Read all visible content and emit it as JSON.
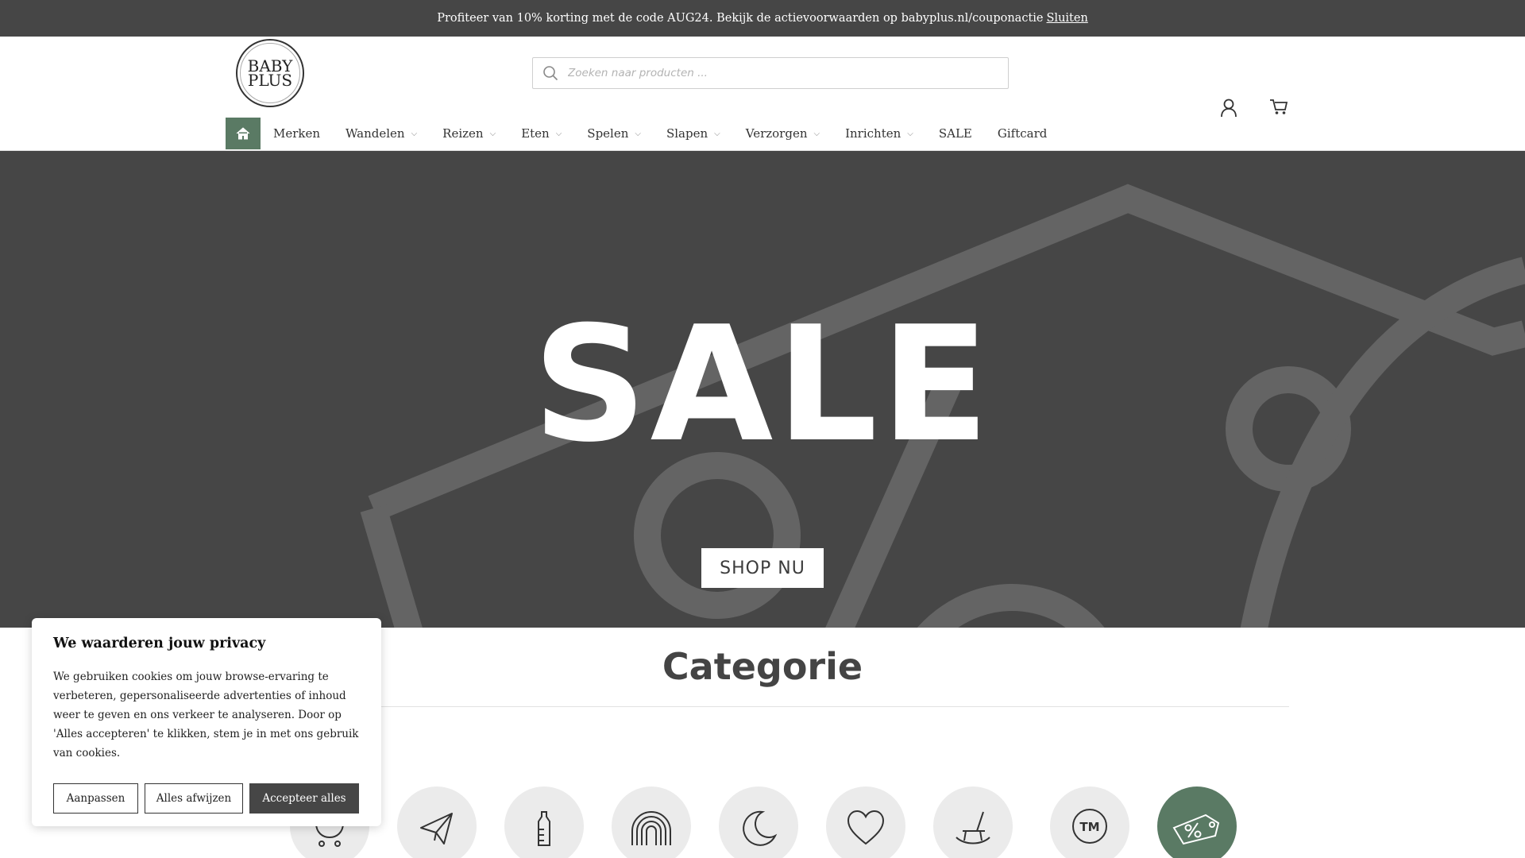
{
  "announcement": {
    "text": "Profiteer van 10% korting met de code AUG24. Bekijk de actievoorwaarden op babyplus.nl/couponactie",
    "link": "Sluiten"
  },
  "logo": {
    "line1": "BABY",
    "line2": "PLUS"
  },
  "search": {
    "placeholder": "Zoeken naar producten ..."
  },
  "nav": {
    "items": [
      {
        "label": "Merken",
        "dropdown": false
      },
      {
        "label": "Wandelen",
        "dropdown": true
      },
      {
        "label": "Reizen",
        "dropdown": true
      },
      {
        "label": "Eten",
        "dropdown": true
      },
      {
        "label": "Spelen",
        "dropdown": true
      },
      {
        "label": "Slapen",
        "dropdown": true
      },
      {
        "label": "Verzorgen",
        "dropdown": true
      },
      {
        "label": "Inrichten",
        "dropdown": true
      },
      {
        "label": "SALE",
        "dropdown": false
      },
      {
        "label": "Giftcard",
        "dropdown": false
      }
    ]
  },
  "hero": {
    "title": "SALE",
    "button": "SHOP NU"
  },
  "categories": {
    "title": "Categorie",
    "icons": [
      "stroller-icon",
      "paper-plane-icon",
      "bottle-icon",
      "rainbow-icon",
      "moon-icon",
      "heart-icon",
      "rocking-chair-icon",
      "tm-icon",
      "sale-tag-icon"
    ]
  },
  "cookie": {
    "title": "We waarderen jouw privacy",
    "text": "We gebruiken cookies om jouw browse-ervaring te verbeteren, gepersonaliseerde advertenties of inhoud weer te geven en ons verkeer te analyseren. Door op 'Alles accepteren' te klikken, stem je in met ons gebruik van cookies.",
    "customize": "Aanpassen",
    "reject": "Alles afwijzen",
    "accept": "Accepteer alles"
  },
  "colors": {
    "dark": "#464646",
    "accent": "#5a7a64",
    "circle": "#ebebeb"
  }
}
